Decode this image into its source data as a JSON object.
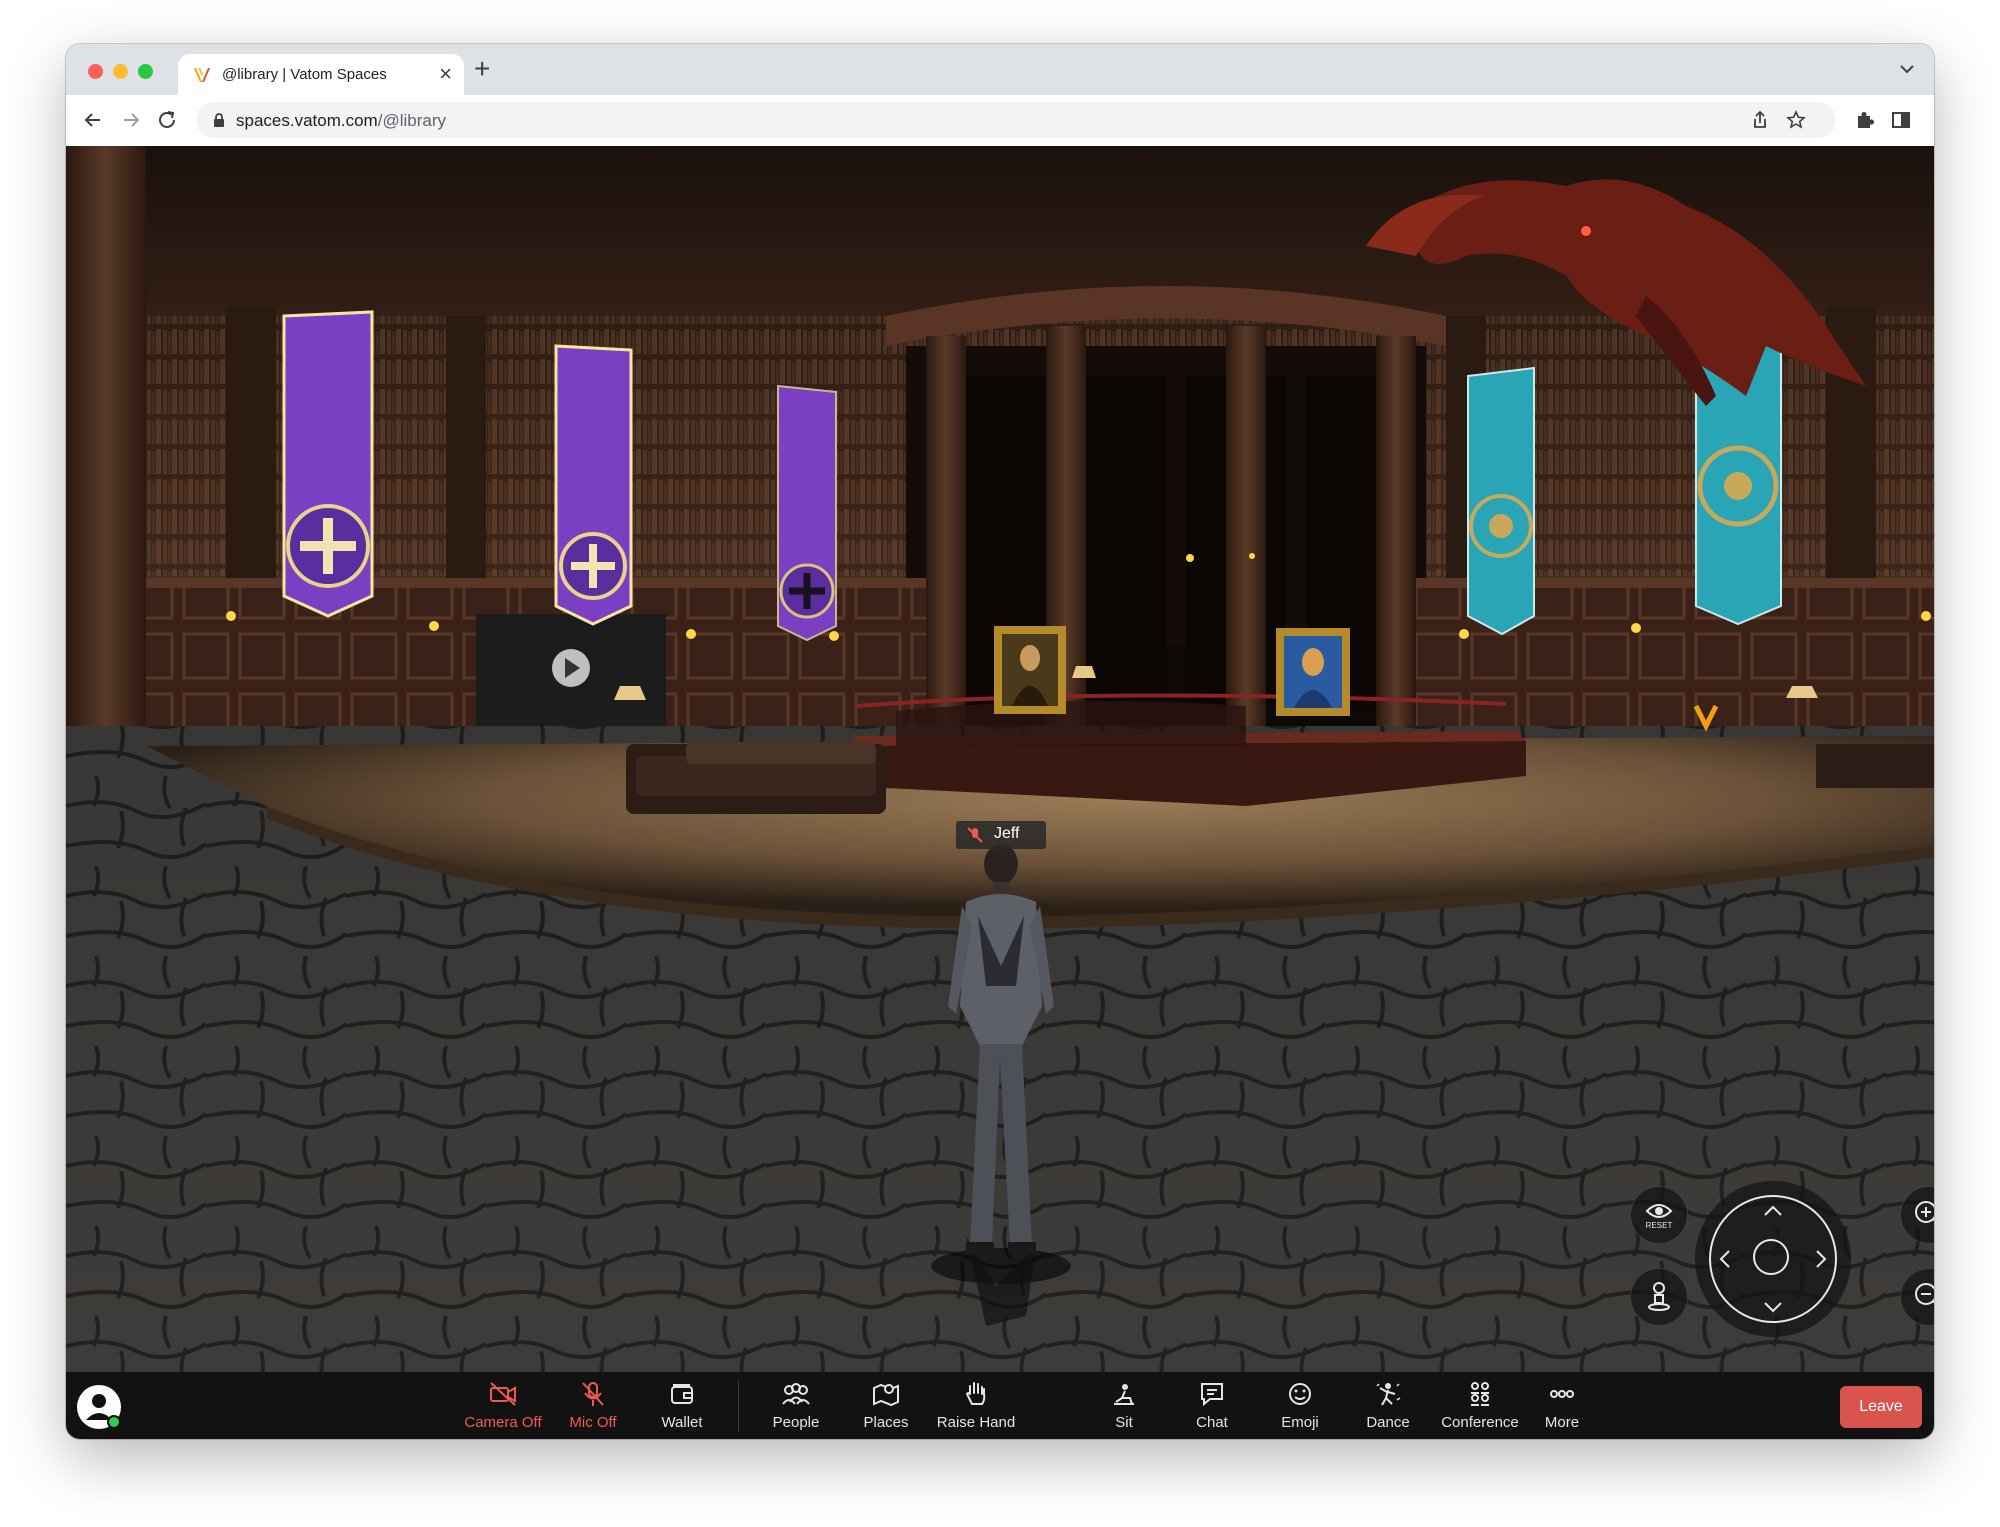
{
  "browser": {
    "tab_title": "@library | Vatom Spaces",
    "tab_close": "×",
    "new_tab": "+",
    "url_host": "spaces.vatom.com",
    "url_path": "/@library"
  },
  "scene": {
    "avatar_name": "Jeff"
  },
  "controls": {
    "reset_label": "RESET"
  },
  "bottom_bar": {
    "camera": "Camera Off",
    "mic": "Mic Off",
    "wallet": "Wallet",
    "people": "People",
    "places": "Places",
    "raise_hand": "Raise Hand",
    "sit": "Sit",
    "chat": "Chat",
    "emoji": "Emoji",
    "dance": "Dance",
    "conference": "Conference",
    "more": "More",
    "leave": "Leave"
  },
  "colors": {
    "leave_button": "#d9534f",
    "muted_red": "#ee5a52",
    "banner_purple": "#7b3fc4",
    "banner_teal": "#2aa5b5"
  }
}
